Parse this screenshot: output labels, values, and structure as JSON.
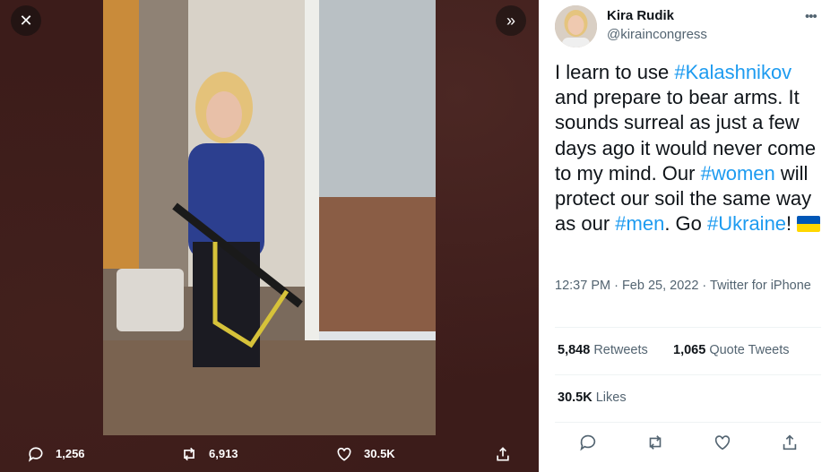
{
  "viewer": {
    "close_icon": "close-icon",
    "expand_icon": "expand-chevrons-icon",
    "actions": {
      "reply_count": "1,256",
      "retweet_count": "6,913",
      "like_count": "30.5K"
    }
  },
  "tweet": {
    "author": {
      "name": "Kira Rudik",
      "handle": "@kiraincongress"
    },
    "text": {
      "t1": "I learn to use ",
      "h1": "#Kalashnikov",
      "t2": " and prepare to bear arms. It sounds surreal as just a few days ago it would never come to my mind. Our ",
      "h2": "#women",
      "t3": " will protect our soil the same way as our ",
      "h3": "#men",
      "t4": ". Go ",
      "h4": "#Ukraine",
      "t5": "!",
      "flag": "ukraine-flag-icon"
    },
    "time": "12:37 PM · Feb 25, 2022 · ",
    "source": "Twitter for iPhone",
    "retweets": {
      "count": "5,848",
      "label": "Retweets"
    },
    "quote_tweets": {
      "count": "1,065",
      "label": "Quote Tweets"
    },
    "likes": {
      "count": "30.5K",
      "label": "Likes"
    }
  },
  "colors": {
    "accent": "#1d9bf0",
    "text": "#0f1419",
    "muted": "#536471",
    "media_bg": "#3c1c1a"
  }
}
